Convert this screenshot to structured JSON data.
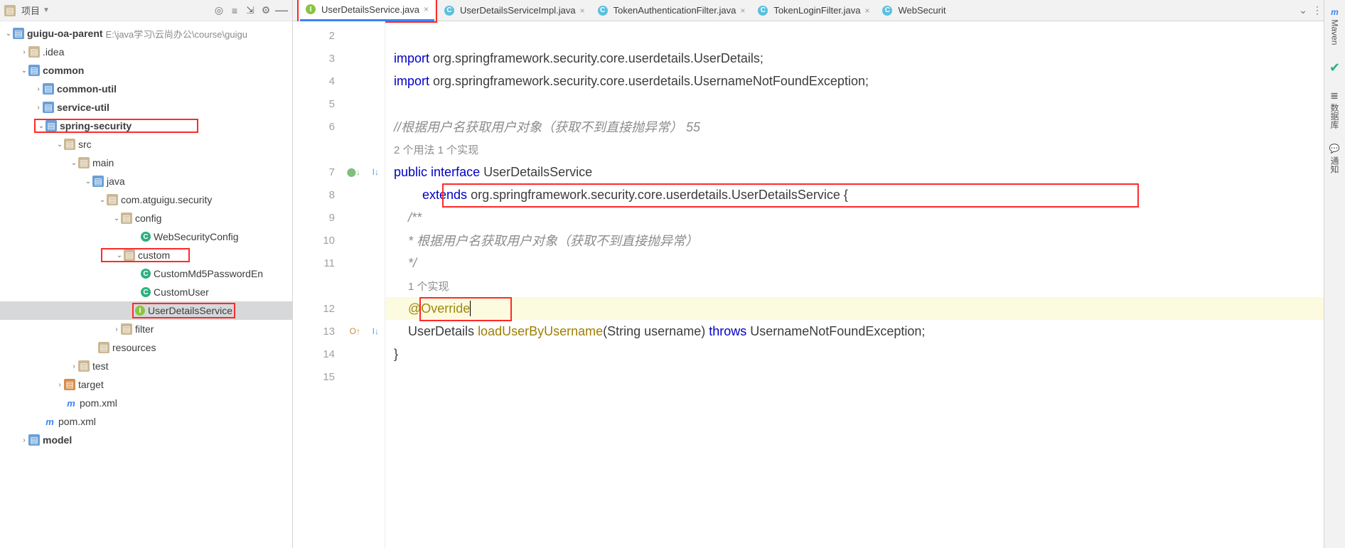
{
  "left": {
    "toolbar": {
      "label": "项目"
    },
    "breadcrumb_path": "E:\\java学习\\云尚办公\\course\\guigu",
    "root": "guigu-oa-parent",
    "items": {
      "idea": ".idea",
      "common": "common",
      "common_util": "common-util",
      "service_util": "service-util",
      "spring_security": "spring-security",
      "src": "src",
      "main": "main",
      "java": "java",
      "pkg": "com.atguigu.security",
      "config": "config",
      "websec": "WebSecurityConfig",
      "custom": "custom",
      "md5": "CustomMd5PasswordEn",
      "cuser": "CustomUser",
      "uds": "UserDetailsService",
      "filter": "filter",
      "resources": "resources",
      "test": "test",
      "target": "target",
      "pom": "pom.xml",
      "pom2": "pom.xml",
      "model": "model"
    }
  },
  "tabs": [
    {
      "label": "UserDetailsService.java",
      "icon": "I",
      "active": true
    },
    {
      "label": "UserDetailsServiceImpl.java",
      "icon": "C",
      "active": false
    },
    {
      "label": "TokenAuthenticationFilter.java",
      "icon": "C",
      "active": false
    },
    {
      "label": "TokenLoginFilter.java",
      "icon": "C",
      "active": false
    },
    {
      "label": "WebSecurit",
      "icon": "C",
      "active": false
    }
  ],
  "code": {
    "lines": [
      "2",
      "3",
      "4",
      "5",
      "6",
      "",
      "7",
      "8",
      "9",
      "10",
      "11",
      "",
      "12",
      "13",
      "14",
      "15"
    ],
    "import_kw": "import",
    "import1": "org.springframework.security.core.userdetails.UserDetails;",
    "import2": "org.springframework.security.core.userdetails.UsernameNotFoundException;",
    "comment1": "//根据用户名获取用户对象（获取不到直接抛异常）  55",
    "usage1": "2 个用法   1 个实现",
    "public": "public",
    "interface": "interface",
    "name": "UserDetailsService",
    "extends": "extends",
    "ext": "org.springframework.security.core.userdetails.UserDetailsService {",
    "doc1": "/**",
    "doc2": " * 根据用户名获取用户对象（获取不到直接抛异常）",
    "doc3": " */",
    "usage2": "1 个实现",
    "override": "@Override",
    "ret": "UserDetails",
    "method": "loadUserByUsername",
    "sig": "(String username)",
    "throws": "throws",
    "exc": "UsernameNotFoundException;",
    "brace": "}"
  },
  "rstrip": {
    "maven": "Maven",
    "db": "数据库",
    "notify": "通知"
  }
}
